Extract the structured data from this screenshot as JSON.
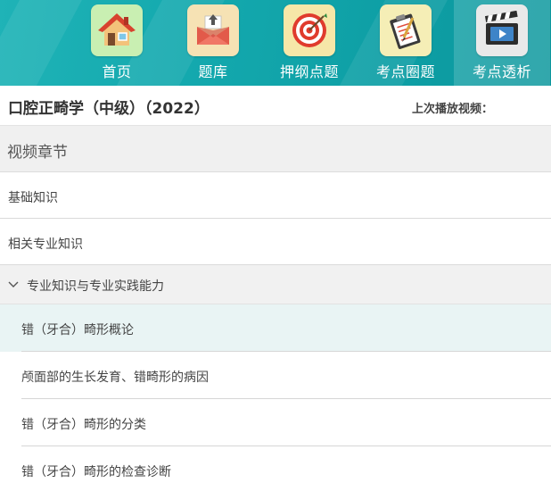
{
  "nav": {
    "items": [
      {
        "label": "首页",
        "icon": "home-icon"
      },
      {
        "label": "题库",
        "icon": "envelope-icon"
      },
      {
        "label": "押纲点题",
        "icon": "target-icon"
      },
      {
        "label": "考点圈题",
        "icon": "clipboard-pen-icon"
      },
      {
        "label": "考点透析",
        "icon": "video-clapper-icon",
        "active": true
      }
    ]
  },
  "course": {
    "title": "口腔正畸学（中级）（2022）",
    "last_play_label": "上次播放视频："
  },
  "section": {
    "title": "视频章节"
  },
  "chapters": [
    {
      "label": "基础知识"
    },
    {
      "label": "相关专业知识"
    },
    {
      "label": "专业知识与专业实践能力",
      "expanded": true,
      "lessons": [
        {
          "label": "错（牙合）畸形概论",
          "selected": true
        },
        {
          "label": "颅面部的生长发育、错畸形的病因"
        },
        {
          "label": "错（牙合）畸形的分类"
        },
        {
          "label": "错（牙合）畸形的检查诊断"
        }
      ]
    }
  ],
  "colors": {
    "nav_bg": "#14a9ae",
    "selected_row_bg": "#e9f4f4",
    "expanded_row_bg": "#f1f1f1"
  }
}
